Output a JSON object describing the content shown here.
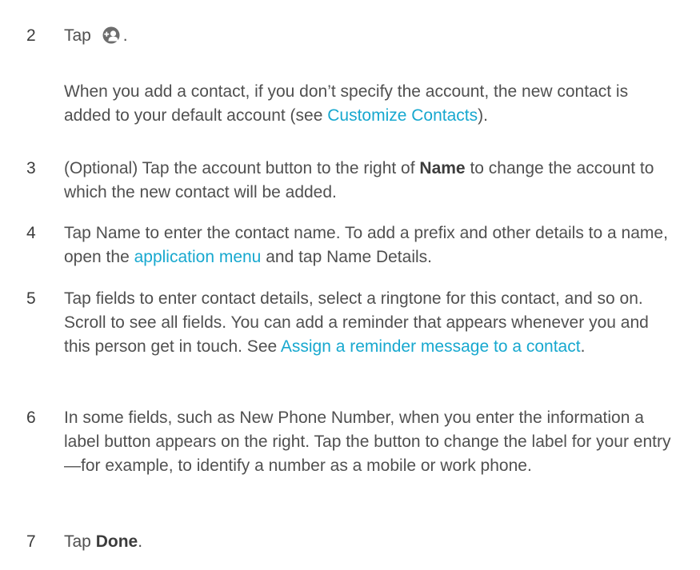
{
  "steps": [
    {
      "num": "2",
      "pre": "Tap ",
      "post": ".",
      "icon": "add-contact-icon"
    },
    {
      "num": "3",
      "t1": "(Optional) Tap the account button to the right of ",
      "bold": "Name",
      "t2": " to change the account to which the new contact will be added."
    },
    {
      "num": "4",
      "t1": "Tap Name to enter the contact name. To add a prefix and other details to a name, open the ",
      "link": "application menu",
      "t2": " and tap Name Details."
    },
    {
      "num": "5",
      "t1": "Tap fields to enter contact details, select a ringtone for this contact, and so on. Scroll to see all fields. You can add a reminder that appears whenever you and this person get in touch. See ",
      "link": "Assign a reminder message to a contact",
      "t2": "."
    },
    {
      "num": "6",
      "t1": "In some fields, such as New Phone Number, when you enter the information a label button appears on the right. Tap the button to change the label for your entry—for example, to identify a number as a mobile or work phone."
    },
    {
      "num": "7",
      "t1": "Tap ",
      "bold": "Done",
      "t2": "."
    }
  ],
  "note": {
    "t1": "When you add a contact, if you don’t specify the account, the new contact is added to your default account (see ",
    "link": "Customize Contacts",
    "t2": ")."
  }
}
